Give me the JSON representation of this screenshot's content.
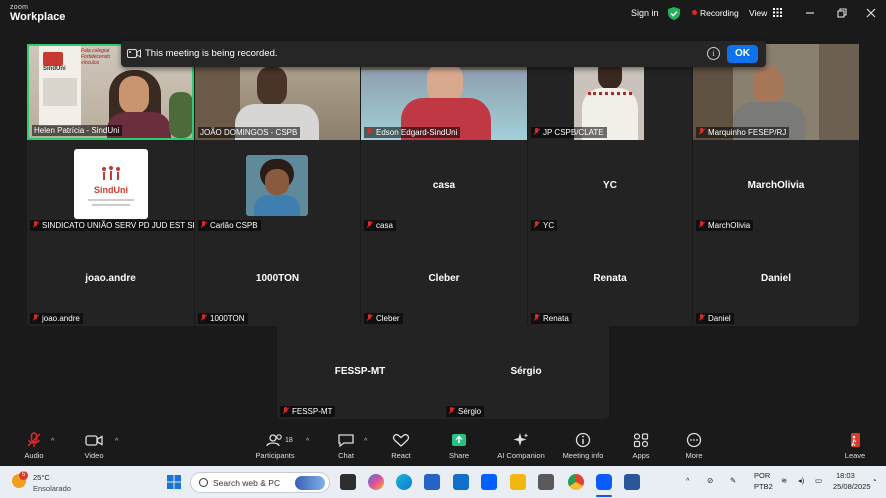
{
  "titlebar": {
    "brand_small": "zoom",
    "brand": "Workplace",
    "sign_in": "Sign in",
    "recording": "Recording",
    "view": "View"
  },
  "banner": {
    "message": "This meeting is being recorded.",
    "ok": "OK",
    "info_glyph": "i"
  },
  "participants": [
    {
      "label": "Helen Patrícia - SindUni",
      "muted": false,
      "video": true
    },
    {
      "label": "JOÃO DOMINGOS - CSPB",
      "muted": false,
      "video": true
    },
    {
      "label": "Edson Edgard-SindUni",
      "muted": true,
      "video": true
    },
    {
      "label": "JP CSPB/CLATE",
      "muted": true,
      "video": true
    },
    {
      "label": "Marquinho FESEP/RJ",
      "muted": true,
      "video": true
    },
    {
      "label": "SINDICATO UNIÃO SERV PD JUD EST SP",
      "muted": true,
      "video": false,
      "avatar": "SindUni"
    },
    {
      "label": "Carlão CSPB",
      "muted": true,
      "video": false
    },
    {
      "name": "casa",
      "label": "casa",
      "muted": true
    },
    {
      "name": "YC",
      "label": "YC",
      "muted": true
    },
    {
      "name": "MarchOlivia",
      "label": "MarchOlivia",
      "muted": true
    },
    {
      "name": "joao.andre",
      "label": "joao.andre",
      "muted": true
    },
    {
      "name": "1000TON",
      "label": "1000TON",
      "muted": true
    },
    {
      "name": "Cleber",
      "label": "Cleber",
      "muted": true
    },
    {
      "name": "Renata",
      "label": "Renata",
      "muted": true
    },
    {
      "name": "Daniel",
      "label": "Daniel",
      "muted": true
    },
    {
      "name": "FESSP-MT",
      "label": "FESSP-MT",
      "muted": true
    },
    {
      "name": "Sérgio",
      "label": "Sérgio",
      "muted": true
    }
  ],
  "sinduni_poster": {
    "brand": "SindUni",
    "tag1": "Fala colegiat",
    "tag2": "Fortalecendo",
    "tag3": "vínculos"
  },
  "toolbar": {
    "audio": "Audio",
    "video": "Video",
    "participants": "Participants",
    "participants_count": "18",
    "chat": "Chat",
    "react": "React",
    "share": "Share",
    "ai": "AI Companion",
    "meeting_info": "Meeting info",
    "apps": "Apps",
    "more": "More",
    "leave": "Leave"
  },
  "taskbar": {
    "weather_badge": "5",
    "temp": "25°C",
    "condition": "Ensolarado",
    "search_placeholder": "Search web & PC",
    "lang1": "POR",
    "lang2": "PTB2",
    "time": "18:03",
    "date": "25/08/2025"
  },
  "colors": {
    "accent": "#0e72ed",
    "share_green": "#26c281",
    "active_border": "#2ecc71",
    "muted_red": "#e02828"
  }
}
